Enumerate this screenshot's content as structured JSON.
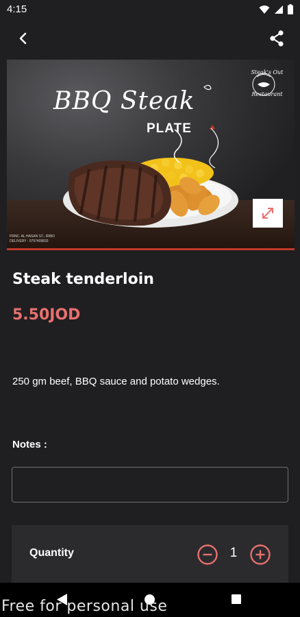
{
  "status_bar": {
    "time": "4:15",
    "icons": [
      "wifi-icon",
      "cell-signal-icon",
      "battery-icon"
    ]
  },
  "app_bar": {
    "back_icon": "chevron-left-icon",
    "share_icon": "share-icon"
  },
  "hero_image": {
    "title": "BBQ Steak",
    "subtitle": "PLATE",
    "logo_text_top": "Steak's Out",
    "logo_text_bottom": "Restaurant",
    "info_line_1": "PRNC. AL HASAN ST., IRBID",
    "info_line_2": "DELIVERY : 0797409833",
    "expand_icon": "expand-icon"
  },
  "product": {
    "name": "Steak tenderloin",
    "price": "5.50JOD",
    "description": "250 gm beef, BBQ sauce and potato wedges."
  },
  "notes": {
    "label": "Notes :",
    "value": "",
    "placeholder": ""
  },
  "quantity": {
    "label": "Quantity",
    "value": "1",
    "minus_icon": "minus-circle-icon",
    "plus_icon": "plus-circle-icon"
  },
  "colors": {
    "background": "#1f1f21",
    "accent": "#e8706e",
    "card": "#2b2b2e"
  },
  "nav_bar": {
    "icons": [
      "nav-back-icon",
      "nav-home-icon",
      "nav-recents-icon"
    ]
  },
  "watermark": "Free for personal use"
}
